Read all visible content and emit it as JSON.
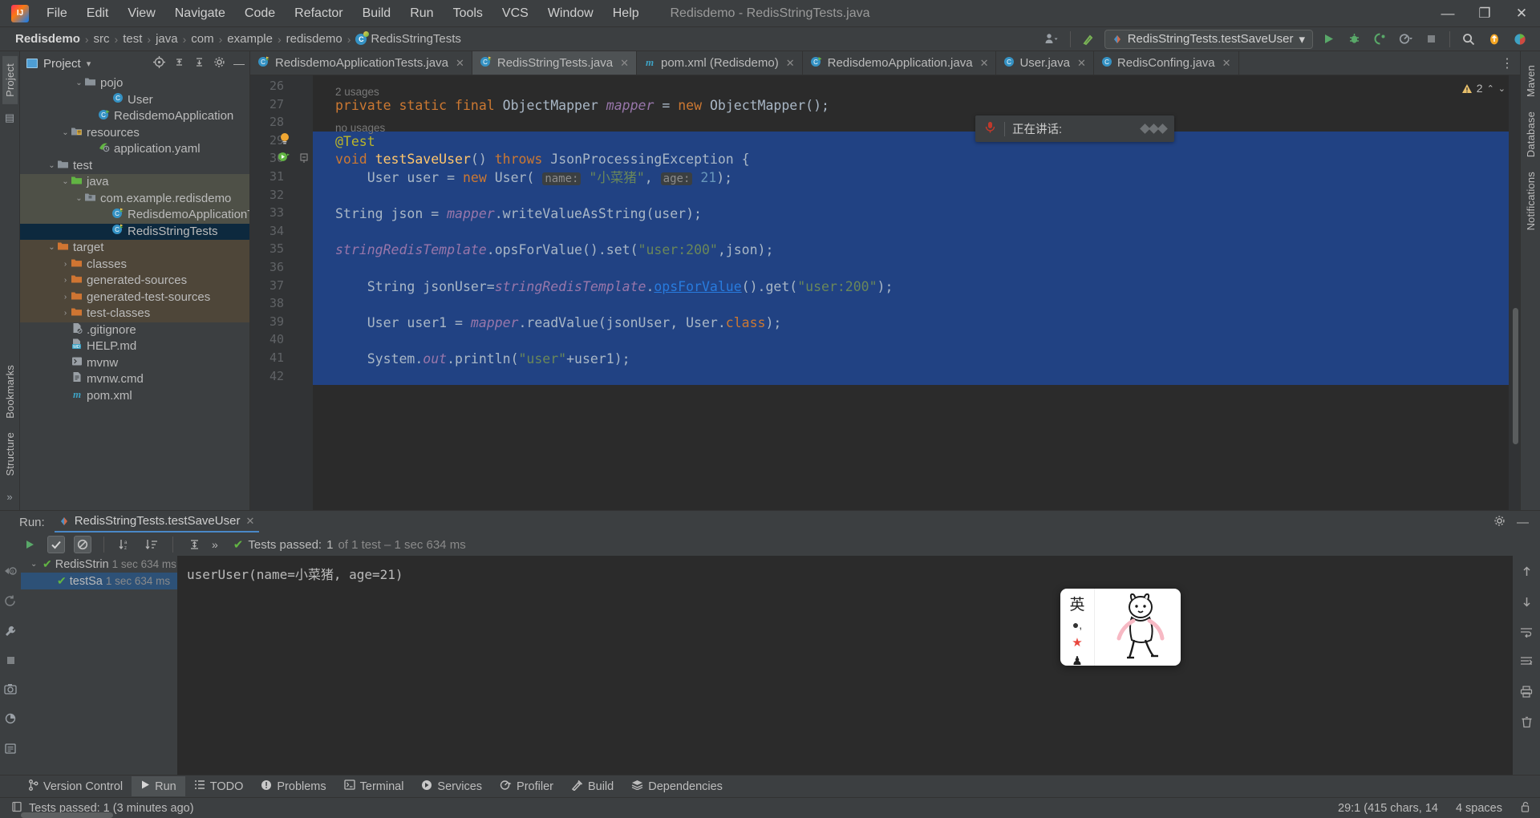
{
  "window": {
    "title": "Redisdemo - RedisStringTests.java",
    "minimize": "—",
    "maximize": "❐",
    "close": "✕"
  },
  "menu": {
    "items": [
      "File",
      "Edit",
      "View",
      "Navigate",
      "Code",
      "Refactor",
      "Build",
      "Run",
      "Tools",
      "VCS",
      "Window",
      "Help"
    ]
  },
  "breadcrumb": {
    "items": [
      "Redisdemo",
      "src",
      "test",
      "java",
      "com",
      "example",
      "redisdemo",
      "RedisStringTests"
    ],
    "separator": "›"
  },
  "toolbar": {
    "run_config": "RedisStringTests.testSaveUser",
    "run_config_caret": "▾",
    "icons": {
      "profile": "user-dropdown-icon",
      "build_hammer": "build-icon",
      "run": "▶",
      "debug": "debug-icon",
      "coverage": "coverage-icon",
      "profiler": "profiler-icon",
      "stop": "■",
      "search": "search-icon",
      "updates": "update-icon",
      "account": "account-icon"
    }
  },
  "left_rail": {
    "items": [
      "Project",
      "Bookmarks",
      "Structure"
    ],
    "active": "Project",
    "more": "»"
  },
  "right_rail": {
    "items": [
      "Maven",
      "Database",
      "Notifications"
    ]
  },
  "project_panel": {
    "title": "Project",
    "caret": "▾",
    "tree": [
      {
        "indent": 4,
        "arrow": "⌄",
        "icon": "folder",
        "label": "pojo",
        "state": "normal"
      },
      {
        "indent": 6,
        "arrow": "",
        "icon": "class",
        "label": "User",
        "state": "normal"
      },
      {
        "indent": 5,
        "arrow": "",
        "icon": "class-run",
        "label": "RedisdemoApplication",
        "state": "normal"
      },
      {
        "indent": 3,
        "arrow": "⌄",
        "icon": "folder-res",
        "label": "resources",
        "state": "normal"
      },
      {
        "indent": 5,
        "arrow": "",
        "icon": "yaml",
        "label": "application.yaml",
        "state": "normal"
      },
      {
        "indent": 2,
        "arrow": "⌄",
        "icon": "folder",
        "label": "test",
        "state": "normal"
      },
      {
        "indent": 3,
        "arrow": "⌄",
        "icon": "folder-test",
        "label": "java",
        "state": "highlight"
      },
      {
        "indent": 4,
        "arrow": "⌄",
        "icon": "package",
        "label": "com.example.redisdemo",
        "state": "highlight"
      },
      {
        "indent": 6,
        "arrow": "",
        "icon": "class-test",
        "label": "RedisdemoApplicationTests",
        "state": "highlight"
      },
      {
        "indent": 6,
        "arrow": "",
        "icon": "class-test",
        "label": "RedisStringTests",
        "state": "selected"
      },
      {
        "indent": 2,
        "arrow": "⌄",
        "icon": "folder-target",
        "label": "target",
        "state": "target"
      },
      {
        "indent": 3,
        "arrow": "›",
        "icon": "folder-target",
        "label": "classes",
        "state": "target"
      },
      {
        "indent": 3,
        "arrow": "›",
        "icon": "folder-target",
        "label": "generated-sources",
        "state": "target"
      },
      {
        "indent": 3,
        "arrow": "›",
        "icon": "folder-target",
        "label": "generated-test-sources",
        "state": "target"
      },
      {
        "indent": 3,
        "arrow": "›",
        "icon": "folder-target",
        "label": "test-classes",
        "state": "target"
      },
      {
        "indent": 3,
        "arrow": "",
        "icon": "gitignore",
        "label": ".gitignore",
        "state": "normal"
      },
      {
        "indent": 3,
        "arrow": "",
        "icon": "markdown",
        "label": "HELP.md",
        "state": "normal"
      },
      {
        "indent": 3,
        "arrow": "",
        "icon": "script",
        "label": "mvnw",
        "state": "normal"
      },
      {
        "indent": 3,
        "arrow": "",
        "icon": "file",
        "label": "mvnw.cmd",
        "state": "normal"
      },
      {
        "indent": 3,
        "arrow": "",
        "icon": "maven",
        "label": "pom.xml",
        "state": "normal"
      }
    ]
  },
  "editor": {
    "tabs": [
      {
        "label": "RedisdemoApplicationTests.java",
        "icon": "class-test-icon",
        "active": false,
        "close": "✕"
      },
      {
        "label": "RedisStringTests.java",
        "icon": "class-test-icon",
        "active": true,
        "close": "✕"
      },
      {
        "label": "pom.xml (Redisdemo)",
        "icon": "maven-icon",
        "active": false,
        "close": "✕"
      },
      {
        "label": "RedisdemoApplication.java",
        "icon": "class-run-icon",
        "active": false,
        "close": "✕"
      },
      {
        "label": "User.java",
        "icon": "class-icon",
        "active": false,
        "close": "✕"
      },
      {
        "label": "RedisConfing.java",
        "icon": "class-icon",
        "active": false,
        "close": "✕"
      }
    ],
    "warning_count": "2",
    "line_numbers": [
      "26",
      "27",
      "28",
      "29",
      "30",
      "31",
      "32",
      "33",
      "34",
      "35",
      "36",
      "37",
      "38",
      "39",
      "40",
      "41",
      "42"
    ],
    "usage_hints": [
      {
        "text": "2 usages",
        "line": 27
      },
      {
        "text": "no usages",
        "line": 29
      }
    ],
    "code_lines": [
      {
        "n": 27,
        "text": "private static final ObjectMapper mapper = new ObjectMapper();"
      },
      {
        "n": 29,
        "text": "@Test"
      },
      {
        "n": 30,
        "text": "void testSaveUser() throws JsonProcessingException {"
      },
      {
        "n": 31,
        "text": "User user = new User( name: \"小菜猪\", age: 21);"
      },
      {
        "n": 33,
        "text": "String json = mapper.writeValueAsString(user);"
      },
      {
        "n": 35,
        "text": "stringRedisTemplate.opsForValue().set(\"user:200\",json);"
      },
      {
        "n": 37,
        "text": "String jsonUser=stringRedisTemplate.opsForValue().get(\"user:200\");"
      },
      {
        "n": 39,
        "text": "User user1 = mapper.readValue(jsonUser, User.class);"
      },
      {
        "n": 41,
        "text": "System.out.println(\"user\"+user1);"
      }
    ],
    "param_hints": [
      "name:",
      "age:"
    ]
  },
  "run_window": {
    "label": "Run:",
    "tab": "RedisStringTests.testSaveUser",
    "tab_close": "✕",
    "status_text": "Tests passed:",
    "status_count": "1",
    "status_detail": "of 1 test – 1 sec 634 ms",
    "toolbar_icons": [
      "rerun-icon",
      "show-passed-icon",
      "show-ignored-icon",
      "sort-alpha-icon",
      "sort-duration-icon",
      "expand-icon",
      "more-icon"
    ],
    "tests": [
      {
        "name": "RedisStrin",
        "time": "1 sec 634 ms",
        "selected": false,
        "arrow": "⌄",
        "status": "✔"
      },
      {
        "name": "testSa",
        "time": "1 sec 634 ms",
        "selected": true,
        "arrow": "",
        "status": "✔"
      }
    ],
    "console_output": "userUser(name=小菜猪, age=21)",
    "settings_icon": "gear-icon",
    "minimize_icon": "—"
  },
  "bottom_tools": [
    {
      "label": "Version Control",
      "icon": "branch-icon",
      "active": false
    },
    {
      "label": "Run",
      "icon": "play-icon",
      "active": true
    },
    {
      "label": "TODO",
      "icon": "todo-icon",
      "active": false
    },
    {
      "label": "Problems",
      "icon": "problems-icon",
      "active": false
    },
    {
      "label": "Terminal",
      "icon": "terminal-icon",
      "active": false
    },
    {
      "label": "Services",
      "icon": "services-icon",
      "active": false
    },
    {
      "label": "Profiler",
      "icon": "profiler-icon",
      "active": false
    },
    {
      "label": "Build",
      "icon": "build-icon",
      "active": false
    },
    {
      "label": "Dependencies",
      "icon": "dependencies-icon",
      "active": false
    }
  ],
  "status_bar": {
    "message": "Tests passed: 1 (3 minutes ago)",
    "caret_position": "29:1 (415 chars, 14",
    "indent": "4 spaces",
    "lock_icon": "lock-icon"
  },
  "overlays": {
    "speech_popup": {
      "label": "正在讲话:",
      "icon": "microphone-icon"
    },
    "ime_panel": {
      "mode": "英",
      "dot": "●,",
      "star": "★",
      "chess": "♟"
    }
  },
  "colors": {
    "accent_blue": "#4a88c7",
    "selection": "#214283",
    "tree_selected": "#0d293e",
    "pass_green": "#62b543",
    "keyword_orange": "#cc7832",
    "string_green": "#6a8759",
    "number_blue": "#6897bb",
    "field_purple": "#9876aa",
    "bg_panel": "#3c3f41",
    "bg_editor": "#2b2b2b"
  }
}
